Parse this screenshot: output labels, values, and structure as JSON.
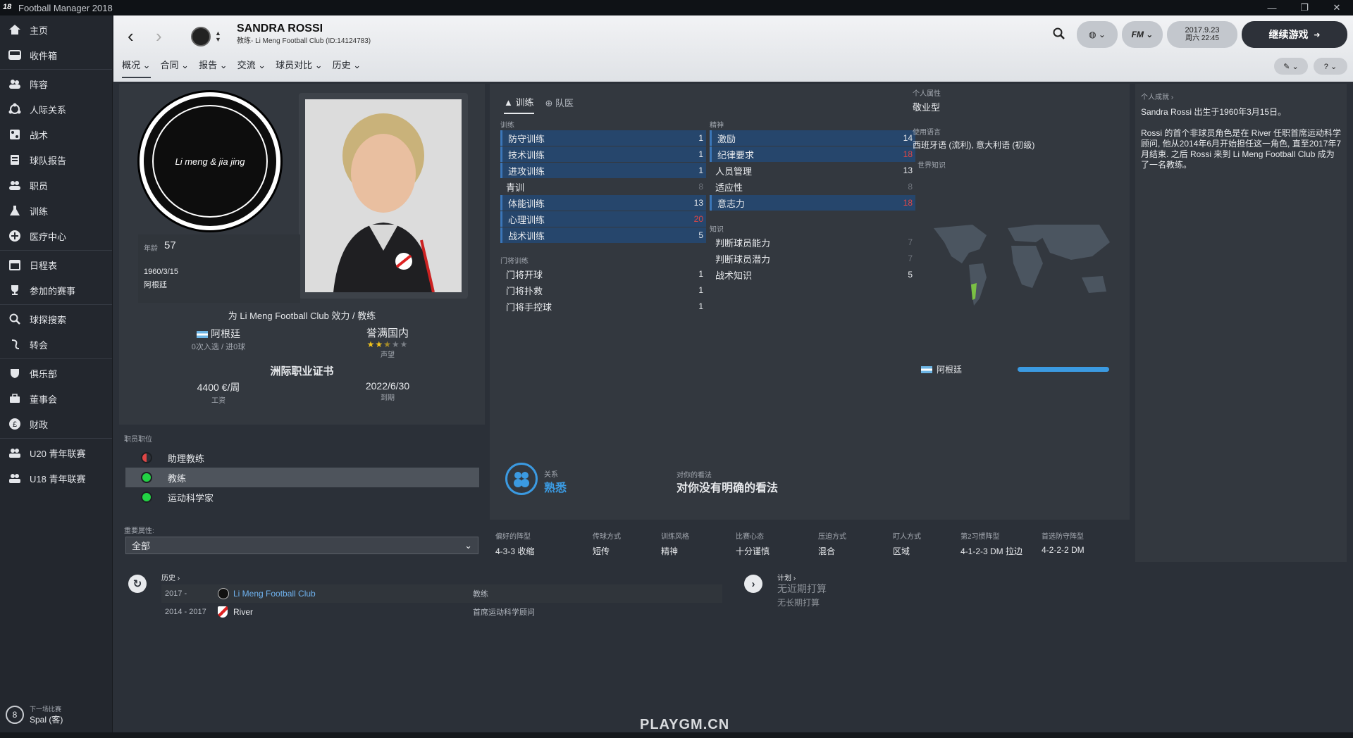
{
  "window": {
    "title": "Football Manager 2018",
    "controls": [
      "—",
      "❐",
      "✕"
    ]
  },
  "sidebar": {
    "items": [
      {
        "label": "主页",
        "icon": "home-icon"
      },
      {
        "label": "收件箱",
        "icon": "inbox-icon"
      },
      {
        "label": "阵容",
        "icon": "squad-icon"
      },
      {
        "label": "人际关系",
        "icon": "relationships-icon"
      },
      {
        "label": "战术",
        "icon": "tactics-icon"
      },
      {
        "label": "球队报告",
        "icon": "report-icon"
      },
      {
        "label": "职员",
        "icon": "staff-icon"
      },
      {
        "label": "训练",
        "icon": "training-icon"
      },
      {
        "label": "医疗中心",
        "icon": "medical-icon"
      },
      {
        "label": "日程表",
        "icon": "calendar-icon"
      },
      {
        "label": "参加的赛事",
        "icon": "trophy-icon"
      },
      {
        "label": "球探搜索",
        "icon": "search-icon"
      },
      {
        "label": "转会",
        "icon": "transfer-icon"
      },
      {
        "label": "俱乐部",
        "icon": "club-icon"
      },
      {
        "label": "董事会",
        "icon": "board-icon"
      },
      {
        "label": "财政",
        "icon": "finance-icon"
      },
      {
        "label": "U20 青年联赛",
        "icon": "u20-icon"
      },
      {
        "label": "U18 青年联赛",
        "icon": "u18-icon"
      }
    ],
    "next_match_label": "下一场比赛",
    "next_match_value": "Spal (客)",
    "next_match_days": "8"
  },
  "header": {
    "name": "SANDRA ROSSI",
    "subtitle": "教练- Li Meng Football Club (ID:14124783)",
    "tabs": [
      "概况",
      "合同",
      "报告",
      "交流",
      "球员对比",
      "历史"
    ],
    "date": "2017.9.23",
    "time": "周六 22:45",
    "continue": "继续游戏",
    "fm": "FM"
  },
  "profile": {
    "badge_text": "Li meng & jia jing",
    "age_label": "年龄",
    "age": "57",
    "dob": "1960/3/15",
    "nationality_small": "阿根廷",
    "club_role": "为 Li Meng Football Club 效力 / 教练",
    "nation": "阿根廷",
    "caps": "0次入选 / 进0球",
    "reputation": "誉满国内",
    "reputation_label": "声望",
    "reputation_stars": 2.5,
    "license": "洲际职业证书",
    "wage": "4400 €/周",
    "wage_label": "工资",
    "expiry": "2022/6/30",
    "expiry_label": "到期"
  },
  "roles": {
    "title": "职员职位",
    "items": [
      {
        "label": "助理教练",
        "color": "#e04646"
      },
      {
        "label": "教练",
        "color": "#22d344"
      },
      {
        "label": "运动科学家",
        "color": "#22d344"
      }
    ],
    "key_attr_label": "重要属性:",
    "key_attr_value": "全部"
  },
  "attrs": {
    "tab_training": "训练",
    "tab_medical": "队医",
    "training_label": "训练",
    "training": [
      {
        "name": "防守训练",
        "value": "1",
        "hl": true
      },
      {
        "name": "技术训练",
        "value": "1",
        "hl": true
      },
      {
        "name": "进攻训练",
        "value": "1",
        "hl": true
      },
      {
        "name": "青训",
        "value": "8",
        "hl": false
      },
      {
        "name": "体能训练",
        "value": "13",
        "hl": true
      },
      {
        "name": "心理训练",
        "value": "20",
        "hl": true
      },
      {
        "name": "战术训练",
        "value": "5",
        "hl": true
      }
    ],
    "gk_label": "门将训练",
    "gk": [
      {
        "name": "门将开球",
        "value": "1"
      },
      {
        "name": "门将扑救",
        "value": "1"
      },
      {
        "name": "门将手控球",
        "value": "1"
      }
    ],
    "mental_label": "精神",
    "mental": [
      {
        "name": "激励",
        "value": "14",
        "hl": true
      },
      {
        "name": "纪律要求",
        "value": "18",
        "hl": true
      },
      {
        "name": "人员管理",
        "value": "13",
        "hl": false
      },
      {
        "name": "适应性",
        "value": "8",
        "hl": false
      },
      {
        "name": "意志力",
        "value": "18",
        "hl": true
      }
    ],
    "knowledge_label": "知识",
    "knowledge": [
      {
        "name": "判断球员能力",
        "value": "7"
      },
      {
        "name": "判断球员潜力",
        "value": "7"
      },
      {
        "name": "战术知识",
        "value": "5"
      }
    ]
  },
  "personal": {
    "personality_label": "个人属性",
    "personality": "敬业型",
    "languages_label": "使用语言",
    "languages": "西班牙语 (流利), 意大利语 (初级)",
    "world_label": "世界知识",
    "country": "阿根廷",
    "country_knowledge": 1.0
  },
  "relation": {
    "label": "关系",
    "value": "熟悉",
    "opinion_label": "对你的看法",
    "opinion": "对你没有明确的看法"
  },
  "prefs": [
    {
      "label": "偏好的阵型",
      "value": "4-3-3 收缩"
    },
    {
      "label": "传球方式",
      "value": "短传"
    },
    {
      "label": "训练风格",
      "value": "精神"
    },
    {
      "label": "比赛心态",
      "value": "十分谨慎"
    },
    {
      "label": "压迫方式",
      "value": "混合"
    },
    {
      "label": "盯人方式",
      "value": "区域"
    },
    {
      "label": "第2习惯阵型",
      "value": "4-1-2-3 DM 拉边"
    },
    {
      "label": "首选防守阵型",
      "value": "4-2-2-2 DM"
    }
  ],
  "achievements": {
    "title": "个人成就",
    "line1": "Sandra Rossi 出生于1960年3月15日。",
    "line2": "Rossi 的首个非球员角色是在 River 任职首席运动科学顾问, 他从2014年6月开始担任这一角色, 直至2017年7月结束. 之后 Rossi 来到 Li Meng Football Club 成为了一名教练。"
  },
  "history": {
    "title": "历史",
    "rows": [
      {
        "years": "2017 -",
        "club": "Li Meng Football Club",
        "role": "教练"
      },
      {
        "years": "2014 - 2017",
        "club": "River",
        "role": "首席运动科学顾问"
      }
    ]
  },
  "plans": {
    "title": "计划",
    "short": "无近期打算",
    "long": "无长期打算"
  },
  "watermark": "PLAYGM.CN",
  "colors": {
    "accent": "#3b76b8",
    "red": "#e04646",
    "green": "#22d344"
  }
}
